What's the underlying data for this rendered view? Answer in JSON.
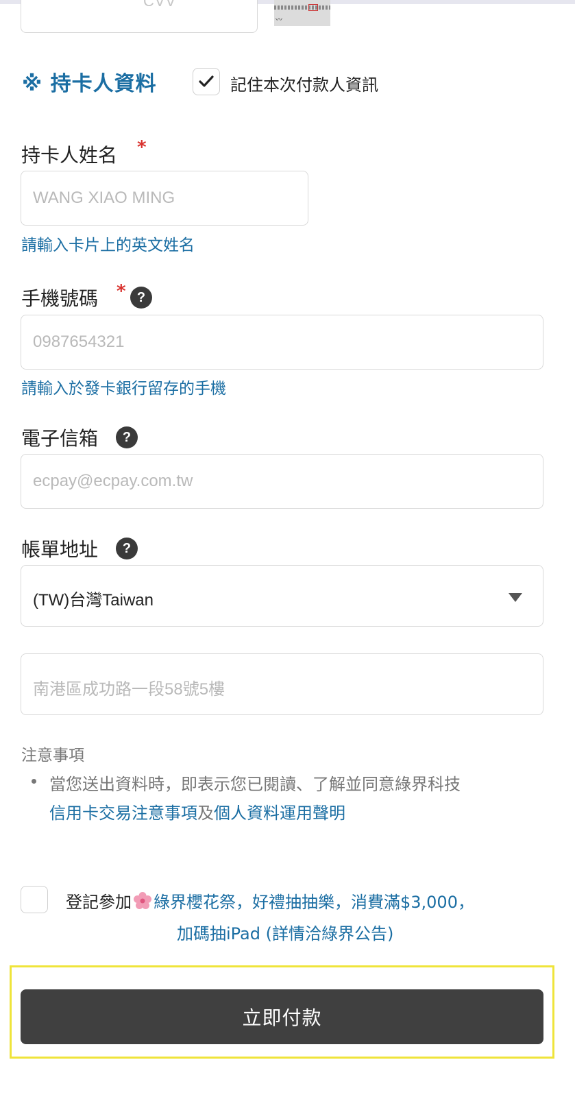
{
  "cvv": {
    "placeholder": "CVV"
  },
  "cardholder_section": {
    "title": "※ 持卡人資料",
    "remember_checkbox": {
      "label": "記住本次付款人資訊",
      "checked": true
    }
  },
  "fields": {
    "name": {
      "label": "持卡人姓名",
      "required_mark": "*",
      "placeholder": "WANG XIAO MING",
      "value": "",
      "hint": "請輸入卡片上的英文姓名"
    },
    "phone": {
      "label": "手機號碼",
      "required_mark": "*",
      "help_icon": "?",
      "placeholder": "0987654321",
      "value": "",
      "hint": "請輸入於發卡銀行留存的手機"
    },
    "email": {
      "label": "電子信箱",
      "help_icon": "?",
      "placeholder": "ecpay@ecpay.com.tw",
      "value": ""
    },
    "billing": {
      "label": "帳單地址",
      "help_icon": "?",
      "country_selected": "(TW)台灣Taiwan",
      "address_placeholder": "南港區成功路一段58號5樓",
      "address_value": ""
    }
  },
  "notes": {
    "title": "注意事項",
    "line1": "當您送出資料時，即表示您已閱讀、了解並同意綠界科技",
    "link1": "信用卡交易注意事項",
    "conjunction": "及",
    "link2": "個人資料運用聲明"
  },
  "promo": {
    "checked": false,
    "prefix": "登記參加",
    "icon": "cherry-blossom-icon",
    "text1": "綠界櫻花祭，好禮抽抽樂，消費滿$3,000，",
    "text2": "加碼抽iPad (詳情洽綠界公告)"
  },
  "pay_button": {
    "label": "立即付款"
  },
  "colors": {
    "accent": "#1b6ea3",
    "required": "#d9322e",
    "button_bg": "#404040",
    "highlight": "#efe43a"
  }
}
